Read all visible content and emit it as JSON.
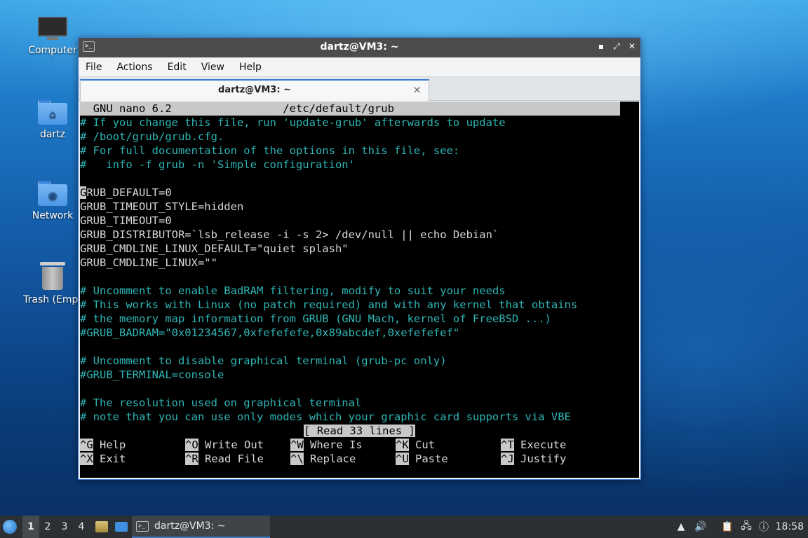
{
  "desktop": {
    "icons": [
      {
        "label": "Computer",
        "icon": "computer-icon"
      },
      {
        "label": "dartz",
        "icon": "home-folder-icon"
      },
      {
        "label": "Network",
        "icon": "network-folder-icon"
      },
      {
        "label": "Trash (Empt",
        "icon": "trash-icon"
      }
    ]
  },
  "window": {
    "title": "dartz@VM3: ~",
    "icon": "terminal-icon",
    "controls": [
      "minimize-icon",
      "maximize-icon",
      "close-icon"
    ],
    "menu": [
      "File",
      "Actions",
      "Edit",
      "View",
      "Help"
    ],
    "tab": {
      "title": "dartz@VM3: ~",
      "close": "×"
    }
  },
  "nano": {
    "header": "  GNU nano 6.2                 /etc/default/grub",
    "lines": [
      {
        "t": "# If you change this file, run 'update-grub' afterwards to update",
        "c": true
      },
      {
        "t": "# /boot/grub/grub.cfg.",
        "c": true
      },
      {
        "t": "# For full documentation of the options in this file, see:",
        "c": true
      },
      {
        "t": "#   info -f grub -n 'Simple configuration'",
        "c": true
      },
      {
        "t": "",
        "c": false
      },
      {
        "t": "GRUB_DEFAULT=0",
        "c": false
      },
      {
        "t": "GRUB_TIMEOUT_STYLE=hidden",
        "c": false
      },
      {
        "t": "GRUB_TIMEOUT=0",
        "c": false
      },
      {
        "t": "GRUB_DISTRIBUTOR=`lsb_release -i -s 2> /dev/null || echo Debian`",
        "c": false
      },
      {
        "t": "GRUB_CMDLINE_LINUX_DEFAULT=\"quiet splash\"",
        "c": false
      },
      {
        "t": "GRUB_CMDLINE_LINUX=\"\"",
        "c": false
      },
      {
        "t": "",
        "c": false
      },
      {
        "t": "# Uncomment to enable BadRAM filtering, modify to suit your needs",
        "c": true
      },
      {
        "t": "# This works with Linux (no patch required) and with any kernel that obtains",
        "c": true
      },
      {
        "t": "# the memory map information from GRUB (GNU Mach, kernel of FreeBSD ...)",
        "c": true
      },
      {
        "t": "#GRUB_BADRAM=\"0x01234567,0xfefefefe,0x89abcdef,0xefefefef\"",
        "c": true
      },
      {
        "t": "",
        "c": false
      },
      {
        "t": "# Uncomment to disable graphical terminal (grub-pc only)",
        "c": true
      },
      {
        "t": "#GRUB_TERMINAL=console",
        "c": true
      },
      {
        "t": "",
        "c": false
      },
      {
        "t": "# The resolution used on graphical terminal",
        "c": true
      },
      {
        "t": "# note that you can use only modes which your graphic card supports via VBE",
        "c": true
      }
    ],
    "status": "[ Read 33 lines ]",
    "shortcuts": [
      [
        {
          "k": "^G",
          "l": "Help"
        },
        {
          "k": "^O",
          "l": "Write Out"
        },
        {
          "k": "^W",
          "l": "Where Is"
        },
        {
          "k": "^K",
          "l": "Cut"
        },
        {
          "k": "^T",
          "l": "Execute"
        }
      ],
      [
        {
          "k": "^X",
          "l": "Exit"
        },
        {
          "k": "^R",
          "l": "Read File"
        },
        {
          "k": "^\\",
          "l": "Replace"
        },
        {
          "k": "^U",
          "l": "Paste"
        },
        {
          "k": "^J",
          "l": "Justify"
        }
      ]
    ]
  },
  "taskbar": {
    "start_icon": "lubuntu-menu-icon",
    "workspaces": [
      "1",
      "2",
      "3",
      "4"
    ],
    "active_workspace": "1",
    "quicklaunch": [
      "file-manager-icon",
      "show-desktop-icon"
    ],
    "task_label": "dartz@VM3: ~",
    "tray": [
      "update-icon",
      "volume-icon",
      "clipboard-icon",
      "network-icon",
      "notification-icon"
    ],
    "clock": "18:58"
  }
}
